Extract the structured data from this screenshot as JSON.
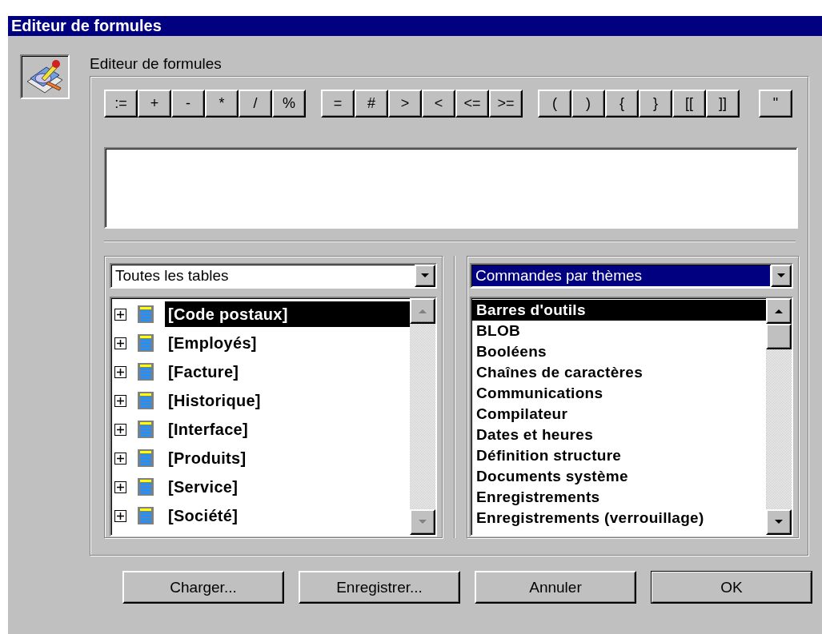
{
  "window": {
    "title": "Editeur de formules"
  },
  "header": {
    "label": "Editeur de formules"
  },
  "operator_groups": [
    [
      ":=",
      "+",
      "-",
      "*",
      "/",
      "%"
    ],
    [
      "=",
      "#",
      ">",
      "<",
      "<=",
      ">="
    ],
    [
      "(",
      ")",
      "{",
      "}",
      "[[",
      "]]"
    ],
    [
      "\""
    ]
  ],
  "tables": {
    "combo": {
      "value": "Toutes les tables",
      "focused": false
    },
    "items": [
      {
        "label": "[Code postaux]",
        "selected": true
      },
      {
        "label": "[Employés]",
        "selected": false
      },
      {
        "label": "[Facture]",
        "selected": false
      },
      {
        "label": "[Historique]",
        "selected": false
      },
      {
        "label": "[Interface]",
        "selected": false
      },
      {
        "label": "[Produits]",
        "selected": false
      },
      {
        "label": "[Service]",
        "selected": false
      },
      {
        "label": "[Société]",
        "selected": false
      }
    ]
  },
  "commands": {
    "combo": {
      "value": "Commandes par thèmes",
      "focused": true
    },
    "items": [
      {
        "label": "Barres d'outils",
        "selected": true
      },
      {
        "label": "BLOB",
        "selected": false
      },
      {
        "label": "Booléens",
        "selected": false
      },
      {
        "label": "Chaînes de caractères",
        "selected": false
      },
      {
        "label": "Communications",
        "selected": false
      },
      {
        "label": "Compilateur",
        "selected": false
      },
      {
        "label": "Dates et heures",
        "selected": false
      },
      {
        "label": "Définition structure",
        "selected": false
      },
      {
        "label": "Documents système",
        "selected": false
      },
      {
        "label": "Enregistrements",
        "selected": false
      },
      {
        "label": "Enregistrements (verrouillage)",
        "selected": false
      }
    ]
  },
  "buttons": [
    "Charger...",
    "Enregistrer...",
    "Annuler",
    "OK"
  ]
}
